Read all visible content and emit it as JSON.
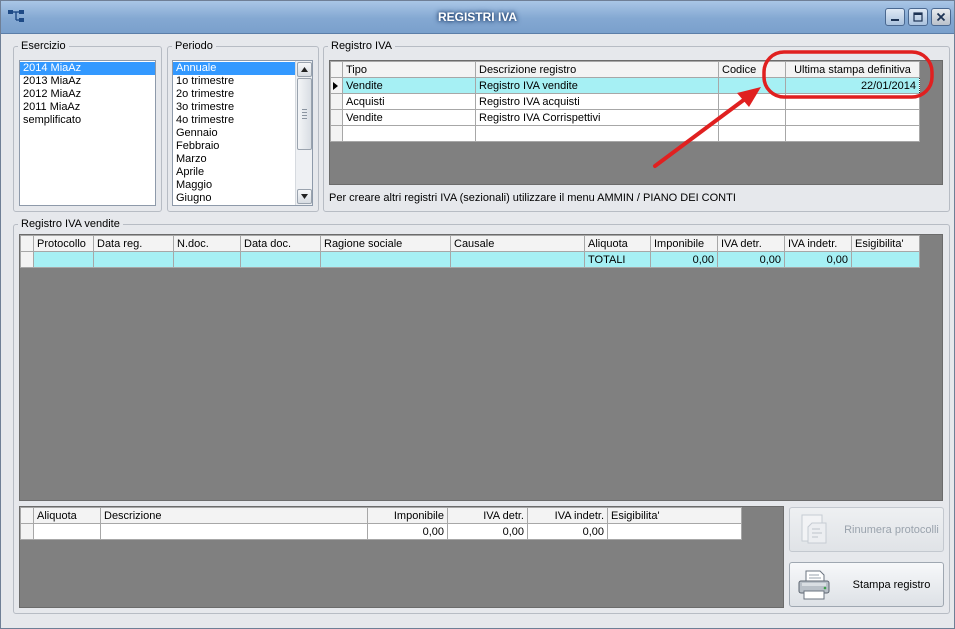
{
  "window": {
    "title": "REGISTRI IVA"
  },
  "esercizio": {
    "legend": "Esercizio",
    "items": [
      "2014 MiaAz",
      "2013 MiaAz",
      "2012 MiaAz",
      "2011 MiaAz",
      "semplificato"
    ],
    "selected": "2014 MiaAz"
  },
  "periodo": {
    "legend": "Periodo",
    "items": [
      "Annuale",
      "1o trimestre",
      "2o trimestre",
      "3o trimestre",
      "4o trimestre",
      "Gennaio",
      "Febbraio",
      "Marzo",
      "Aprile",
      "Maggio",
      "Giugno"
    ],
    "selected": "Annuale"
  },
  "registro_iva": {
    "legend": "Registro IVA",
    "columns": [
      "Tipo",
      "Descrizione registro",
      "Codice",
      "Ultima stampa definitiva"
    ],
    "rows": [
      {
        "tipo": "Vendite",
        "descrizione": "Registro IVA vendite",
        "codice": "",
        "ultima_stampa": "22/01/2014"
      },
      {
        "tipo": "Acquisti",
        "descrizione": "Registro IVA acquisti",
        "codice": "",
        "ultima_stampa": ""
      },
      {
        "tipo": "Vendite",
        "descrizione": "Registro IVA Corrispettivi",
        "codice": "",
        "ultima_stampa": ""
      }
    ],
    "hint": "Per creare altri registri IVA (sezionali) utilizzare il menu AMMIN / PIANO DEI CONTI"
  },
  "registro_vendite": {
    "legend": "Registro IVA vendite",
    "columns": [
      "Protocollo",
      "Data reg.",
      "N.doc.",
      "Data doc.",
      "Ragione sociale",
      "Causale",
      "Aliquota",
      "Imponibile",
      "IVA detr.",
      "IVA indetr.",
      "Esigibilita'"
    ],
    "totals": {
      "aliquota": "TOTALI",
      "imponibile": "0,00",
      "iva_detr": "0,00",
      "iva_indetr": "0,00"
    }
  },
  "riepilogo": {
    "columns": [
      "Aliquota",
      "Descrizione",
      "Imponibile",
      "IVA detr.",
      "IVA indetr.",
      "Esigibilita'"
    ],
    "row": {
      "imponibile": "0,00",
      "iva_detr": "0,00",
      "iva_indetr": "0,00"
    }
  },
  "buttons": {
    "rinumera": "Rinumera protocolli",
    "stampa": "Stampa registro"
  },
  "icons": [
    "app-network-icon",
    "minimize-icon",
    "maximize-icon",
    "close-icon",
    "scroll-up-icon",
    "scroll-down-icon",
    "row-pointer-icon",
    "renumber-icon",
    "printer-icon"
  ],
  "colors": {
    "selection": "#3399ff",
    "highlight_row": "#a6f0f4",
    "grid_background": "#808080",
    "annotation": "#e02020"
  }
}
